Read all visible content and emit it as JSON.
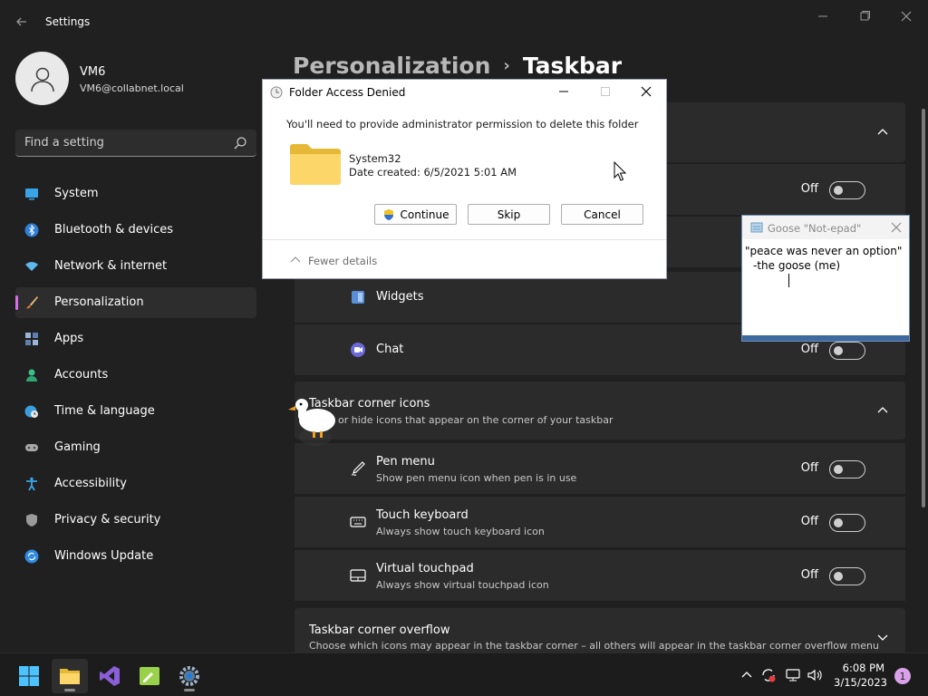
{
  "window": {
    "app_title": "Settings",
    "back_icon": "back-arrow-icon",
    "controls": [
      "minimize-icon",
      "maximize-icon",
      "close-icon"
    ]
  },
  "user": {
    "name": "VM6",
    "email": "VM6@collabnet.local"
  },
  "search": {
    "placeholder": "Find a setting"
  },
  "sidebar": {
    "accent": "#d56fe8",
    "items": [
      {
        "label": "System",
        "icon": "monitor-icon",
        "active": false
      },
      {
        "label": "Bluetooth & devices",
        "icon": "bluetooth-icon",
        "active": false
      },
      {
        "label": "Network & internet",
        "icon": "wifi-icon",
        "active": false
      },
      {
        "label": "Personalization",
        "icon": "brush-icon",
        "active": true
      },
      {
        "label": "Apps",
        "icon": "apps-icon",
        "active": false
      },
      {
        "label": "Accounts",
        "icon": "person-icon",
        "active": false
      },
      {
        "label": "Time & language",
        "icon": "clock-globe-icon",
        "active": false
      },
      {
        "label": "Gaming",
        "icon": "gamepad-icon",
        "active": false
      },
      {
        "label": "Accessibility",
        "icon": "accessibility-icon",
        "active": false
      },
      {
        "label": "Privacy & security",
        "icon": "shield-icon",
        "active": false
      },
      {
        "label": "Windows Update",
        "icon": "update-icon",
        "active": false
      }
    ]
  },
  "breadcrumb": {
    "parent": "Personalization",
    "separator": "›",
    "current": "Taskbar"
  },
  "taskbar_items": {
    "first_toggle_state": "Off",
    "widgets": {
      "label": "Widgets"
    },
    "chat": {
      "label": "Chat",
      "state": "Off"
    }
  },
  "corner_icons": {
    "title": "Taskbar corner icons",
    "subtitle": "or hide icons that appear on the corner of your taskbar",
    "rows": [
      {
        "title": "Pen menu",
        "subtitle": "Show pen menu icon when pen is in use",
        "state": "Off",
        "icon": "pen-icon"
      },
      {
        "title": "Touch keyboard",
        "subtitle": "Always show touch keyboard icon",
        "state": "Off",
        "icon": "keyboard-icon"
      },
      {
        "title": "Virtual touchpad",
        "subtitle": "Always show virtual touchpad icon",
        "state": "Off",
        "icon": "touchpad-icon"
      }
    ]
  },
  "corner_overflow": {
    "title": "Taskbar corner overflow",
    "subtitle": "Choose which icons may appear in the taskbar corner – all others will appear in the taskbar corner overflow menu"
  },
  "dialog": {
    "title": "Folder Access Denied",
    "message": "You'll need to provide administrator permission to delete this folder",
    "folder_name": "System32",
    "folder_date": "Date created: 6/5/2021 5:01 AM",
    "continue_label": "Continue",
    "skip_label": "Skip",
    "cancel_label": "Cancel",
    "fewer_details": "Fewer details"
  },
  "notepad": {
    "title": "Goose \"Not-epad\"",
    "line1": "\"peace was never an option\"",
    "line2": "-the goose (me)"
  },
  "taskbar": {
    "apps": [
      "start-icon",
      "file-explorer-icon",
      "visual-studio-icon",
      "notepad-app-icon",
      "settings-icon"
    ],
    "time": "6:08 PM",
    "date": "3/15/2023",
    "notification_count": "1"
  }
}
